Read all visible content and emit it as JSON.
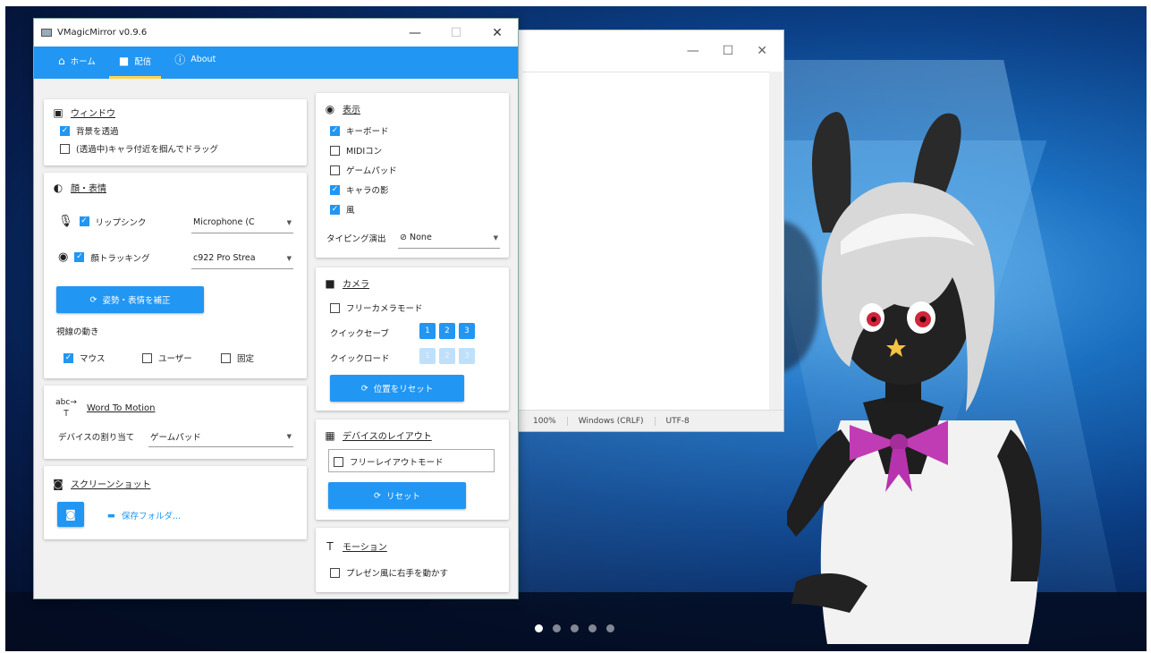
{
  "window": {
    "title": "VMagicMirror v0.9.6",
    "tabs": [
      {
        "label": "ホーム",
        "icon": "home-icon",
        "active": false
      },
      {
        "label": "配信",
        "icon": "video-camera-icon",
        "active": true
      },
      {
        "label": "About",
        "icon": "help-circle-icon",
        "active": false
      }
    ]
  },
  "window_section": {
    "title": "ウィンドウ",
    "transparent_bg": {
      "label": "背景を透過",
      "checked": true
    },
    "drag_character": {
      "label": "(透過中)キャラ付近を掴んでドラッグ",
      "checked": false
    }
  },
  "face_section": {
    "title": "顔・表情",
    "lipsync": {
      "label": "リップシンク",
      "checked": true,
      "device": "Microphone (C"
    },
    "face_tracking": {
      "label": "顔トラッキング",
      "checked": true,
      "camera": "c922 Pro Strea"
    },
    "calibrate_button": "姿勢・表情を補正",
    "gaze_label": "視線の動き",
    "gaze_mouse": {
      "label": "マウス",
      "checked": true
    },
    "gaze_user": {
      "label": "ユーザー",
      "checked": false
    },
    "gaze_fixed": {
      "label": "固定",
      "checked": false
    }
  },
  "wtm_section": {
    "title": "Word To Motion",
    "device_label": "デバイスの割り当て",
    "device_value": "ゲームパッド"
  },
  "screenshot_section": {
    "title": "スクリーンショット",
    "folder_label": "保存フォルダ..."
  },
  "display_section": {
    "title": "表示",
    "keyboard": {
      "label": "キーボード",
      "checked": true
    },
    "midi": {
      "label": "MIDIコン",
      "checked": false
    },
    "gamepad": {
      "label": "ゲームパッド",
      "checked": false
    },
    "shadow": {
      "label": "キャラの影",
      "checked": true
    },
    "wind": {
      "label": "風",
      "checked": true
    },
    "typing_effect_label": "タイピング演出",
    "typing_effect_value": "None"
  },
  "camera_section": {
    "title": "カメラ",
    "free_camera": {
      "label": "フリーカメラモード",
      "checked": false
    },
    "quick_save_label": "クイックセーブ",
    "quick_load_label": "クイックロード",
    "slots": [
      "1",
      "2",
      "3"
    ],
    "reset_button": "位置をリセット"
  },
  "layout_section": {
    "title": "デバイスのレイアウト",
    "free_layout": {
      "label": "フリーレイアウトモード",
      "checked": false
    },
    "reset_button": "リセット"
  },
  "motion_section": {
    "title": "モーション",
    "presenter_hand": {
      "label": "プレゼン風に右手を動かす",
      "checked": false
    }
  },
  "notepad": {
    "status_zoom": "100%",
    "status_eol": "Windows (CRLF)",
    "status_enc": "UTF-8"
  },
  "pager": {
    "count": 5,
    "active": 0
  },
  "colors": {
    "accent": "#2196f3",
    "tab_underline": "#ffd54f"
  }
}
